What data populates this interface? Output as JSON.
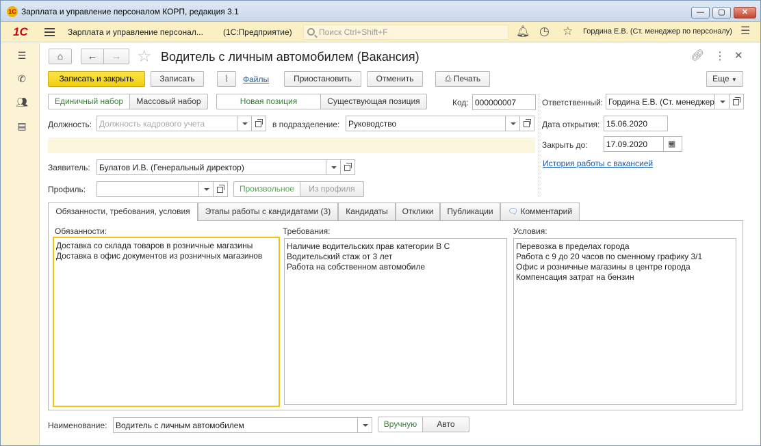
{
  "window": {
    "title": "Зарплата и управление персоналом КОРП, редакция 3.1",
    "logo": "1C"
  },
  "appbar": {
    "brand": "1С",
    "title": "Зарплата и управление персонал...",
    "subtitle": "(1С:Предприятие)",
    "search_placeholder": "Поиск Ctrl+Shift+F",
    "user": "Гордина Е.В. (Ст. менеджер по персоналу)"
  },
  "form": {
    "title": "Водитель с личным автомобилем (Вакансия)",
    "toolbar": {
      "save_close": "Записать и закрыть",
      "save": "Записать",
      "files": "Файлы",
      "suspend": "Приостановить",
      "cancel": "Отменить",
      "print": "Печать",
      "more": "Еще"
    },
    "hiring": {
      "single": "Единичный набор",
      "mass": "Массовый набор"
    },
    "position": {
      "new": "Новая позиция",
      "existing": "Существующая позиция"
    },
    "code": {
      "label": "Код:",
      "value": "000000007"
    },
    "responsible": {
      "label": "Ответственный:",
      "value": "Гордина Е.В. (Ст. менеджер по персоналу)"
    },
    "post": {
      "label": "Должность:",
      "placeholder": "Должность кадрового учета"
    },
    "department": {
      "label": "в подразделение:",
      "value": "Руководство"
    },
    "open_date": {
      "label": "Дата открытия:",
      "value": "15.06.2020"
    },
    "close_by": {
      "label": "Закрыть до:",
      "value": "17.09.2020"
    },
    "history_link": "История работы с вакансией",
    "applicant": {
      "label": "Заявитель:",
      "value": "Булатов И.В. (Генеральный директор)"
    },
    "profile": {
      "label": "Профиль:",
      "value": "",
      "free": "Произвольное",
      "from_profile": "Из профиля"
    },
    "tabs": [
      {
        "label": "Обязанности, требования, условия"
      },
      {
        "label": "Этапы работы с кандидатами (3)"
      },
      {
        "label": "Кандидаты"
      },
      {
        "label": "Отклики"
      },
      {
        "label": "Публикации"
      },
      {
        "label": "Комментарий"
      }
    ],
    "duties": {
      "label": "Обязанности:",
      "text": "Доставка со склада товаров в розничные магазины\nДоставка в офис документов из розничных магазинов"
    },
    "requirements": {
      "label": "Требования:",
      "text": "Наличие водительских прав категории В С\nВодительский стаж от 3 лет\nРабота на собственном автомобиле"
    },
    "conditions": {
      "label": "Условия:",
      "text": "Перевозка в пределах города\nРабота с 9 до 20 часов по сменному графику 3/1\nОфис и розничные магазины в центре города\nКомпенсация затрат на бензин"
    },
    "name": {
      "label": "Наименование:",
      "value": "Водитель с личным автомобилем",
      "manual": "Вручную",
      "auto": "Авто"
    }
  }
}
